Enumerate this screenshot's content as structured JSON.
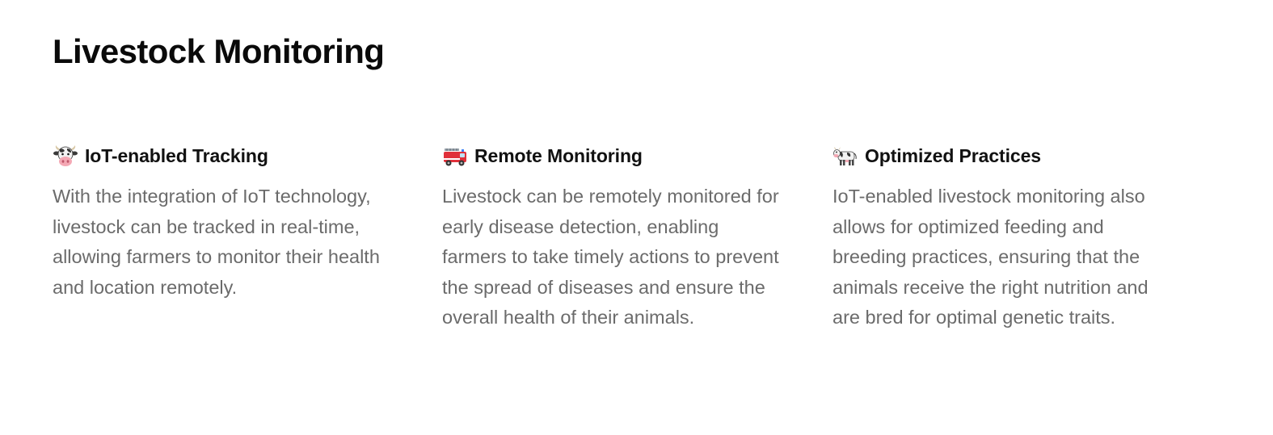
{
  "page": {
    "title": "Livestock Monitoring"
  },
  "features": [
    {
      "icon": "cow-face-icon",
      "title": "IoT-enabled Tracking",
      "body": "With the integration of IoT technology, livestock can be tracked in real-time, allowing farmers to monitor their health and location remotely."
    },
    {
      "icon": "fire-engine-icon",
      "title": "Remote Monitoring",
      "body": "Livestock can be remotely monitored for early disease detection, enabling farmers to take timely actions to prevent the spread of diseases and ensure the overall health of their animals."
    },
    {
      "icon": "cow-icon",
      "title": "Optimized Practices",
      "body": "IoT-enabled livestock monitoring also allows for optimized feeding and breeding practices, ensuring that the animals receive the right nutrition and are bred for optimal genetic traits."
    }
  ],
  "colors": {
    "title": "#0a0a0a",
    "heading": "#111111",
    "body_text": "#6b6b6b",
    "background": "#ffffff"
  }
}
